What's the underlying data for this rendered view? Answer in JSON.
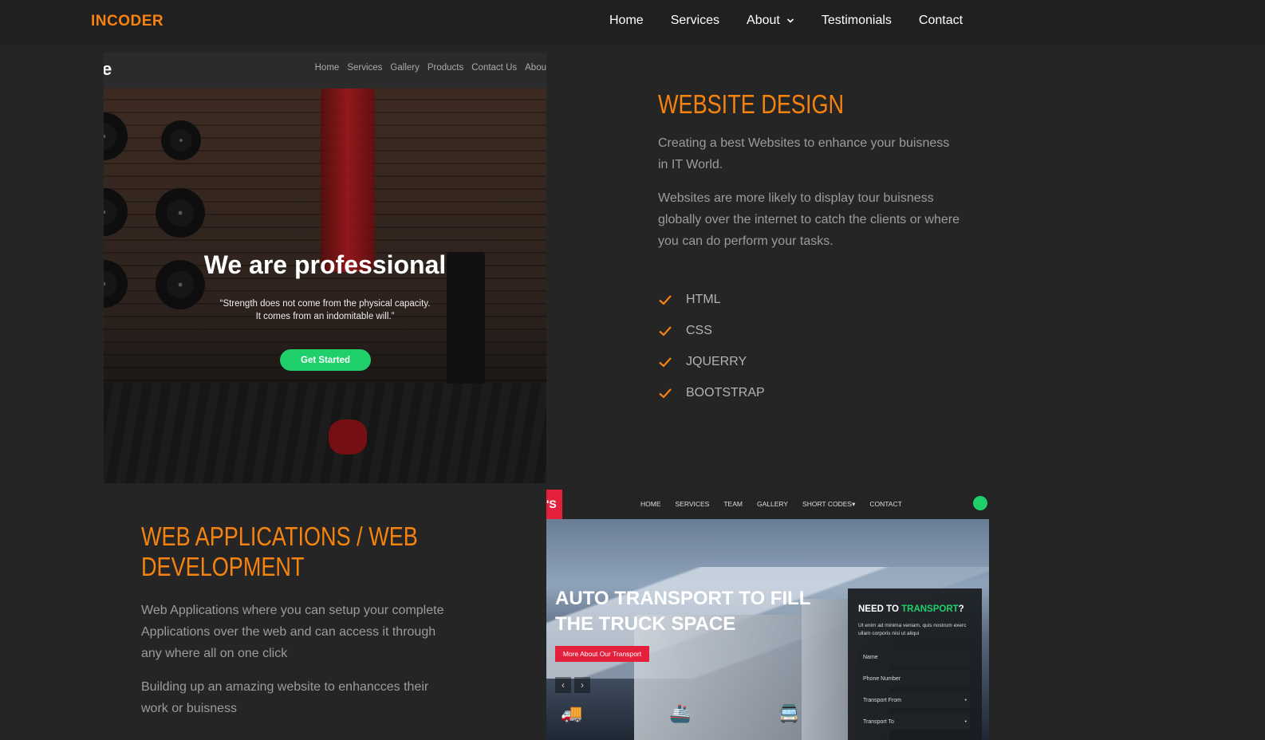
{
  "header": {
    "logo": "INCODER",
    "nav": [
      {
        "label": "Home"
      },
      {
        "label": "Services"
      },
      {
        "label": "About",
        "has_dropdown": true
      },
      {
        "label": "Testimonials"
      },
      {
        "label": "Contact"
      }
    ]
  },
  "website_design": {
    "title": "WEBSITE DESIGN",
    "paragraphs": [
      "Creating a best Websites to enhance your buisness in IT World.",
      "Websites are more likely to display tour buisness globally over the internet to catch the clients or where you can do perform your tasks."
    ],
    "skills": [
      "HTML",
      "CSS",
      "JQUERRY",
      "BOOTSTRAP"
    ],
    "preview": {
      "logo_fragment": "e",
      "nav": [
        "Home",
        "Services",
        "Gallery",
        "Products",
        "Contact Us",
        "Abou"
      ],
      "hero_title": "We are professional",
      "hero_quote": "“Strength does not come from the physical capacity.\nIt comes from an indomitable will.”",
      "hero_button": "Get Started"
    }
  },
  "web_apps": {
    "title": "WEB APPLICATIONS / WEB DEVELOPMENT",
    "paragraphs": [
      "Web Applications where you can setup your complete Applications over the web and can access it through any where all on one click",
      "Building up an amazing website to enhancces their work or buisness"
    ],
    "preview": {
      "logo_fragment": "'S",
      "nav": [
        "HOME",
        "SERVICES",
        "TEAM",
        "GALLERY",
        "SHORT CODES▾",
        "CONTACT"
      ],
      "hero_title": "AUTO TRANSPORT TO FILL\nTHE TRUCK SPACE",
      "hero_button": "More About Our Transport",
      "form_title_prefix": "NEED TO ",
      "form_title_highlight": "TRANSPORT",
      "form_title_suffix": "?",
      "form_text": "Ut enim ad minima veniam, quis nostrum exerc ullam corporis nisi ut aliqui",
      "fields": [
        "Name",
        "Phone Number",
        "Transport From",
        "Transport To"
      ]
    }
  },
  "colors": {
    "accent": "#f7830f",
    "background": "#252525",
    "header_bg": "#202020",
    "green_button": "#1fcf6a",
    "red_accent": "#e5203d"
  }
}
